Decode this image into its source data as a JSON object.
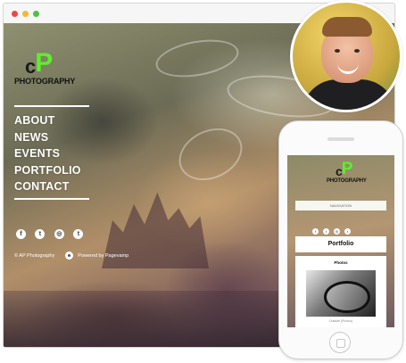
{
  "desktop": {
    "logo": {
      "letter_c": "c",
      "letter_p": "P",
      "word": "PHOTOGRAPHY"
    },
    "nav_items": [
      "ABOUT",
      "NEWS",
      "EVENTS",
      "PORTFOLIO",
      "CONTACT"
    ],
    "social_icons": [
      {
        "name": "facebook-icon",
        "glyph": "f"
      },
      {
        "name": "twitter-icon",
        "glyph": "t"
      },
      {
        "name": "instagram-icon",
        "glyph": "◎"
      },
      {
        "name": "tumblr-icon",
        "glyph": "t"
      }
    ],
    "footer": {
      "copyright": "© AP Photography",
      "powered_by": "Powered by Pagevamp"
    },
    "colors": {
      "brand_green": "#5cf02a",
      "text": "#ffffff"
    }
  },
  "mobile": {
    "logo": {
      "letter_c": "c",
      "letter_p": "P",
      "word": "PHOTOGRAPHY"
    },
    "navigation_label": "NAVIGATION",
    "social_icons": [
      {
        "name": "facebook-icon",
        "glyph": "f"
      },
      {
        "name": "twitter-icon",
        "glyph": "t"
      },
      {
        "name": "instagram-icon",
        "glyph": "◎"
      },
      {
        "name": "tumblr-icon",
        "glyph": "t"
      }
    ],
    "section_heading": "Portfolio",
    "card": {
      "title": "Photos",
      "caption": "Outside (Photos)"
    }
  }
}
